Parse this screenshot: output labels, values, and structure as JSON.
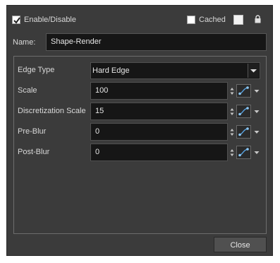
{
  "header": {
    "enable_label": "Enable/Disable",
    "enable_checked": true,
    "cached_label": "Cached",
    "cached_checked": false
  },
  "name": {
    "label": "Name:",
    "value": "Shape-Render"
  },
  "properties": {
    "edge_type": {
      "label": "Edge Type",
      "value": "Hard Edge"
    },
    "scale": {
      "label": "Scale",
      "value": "100"
    },
    "discretization_scale": {
      "label": "Discretization Scale",
      "value": "15"
    },
    "pre_blur": {
      "label": "Pre-Blur",
      "value": "0"
    },
    "post_blur": {
      "label": "Post-Blur",
      "value": "0"
    }
  },
  "footer": {
    "close_label": "Close"
  },
  "colors": {
    "dialog_bg": "#3b3b3b",
    "field_bg": "#161616",
    "accent_curve": "#5aa6e6"
  },
  "icons": [
    "checkmark-icon",
    "color-swatch-icon",
    "lock-icon",
    "dropdown-arrow-icon",
    "spinner-icon",
    "function-curve-icon",
    "small-arrow-down-icon"
  ]
}
